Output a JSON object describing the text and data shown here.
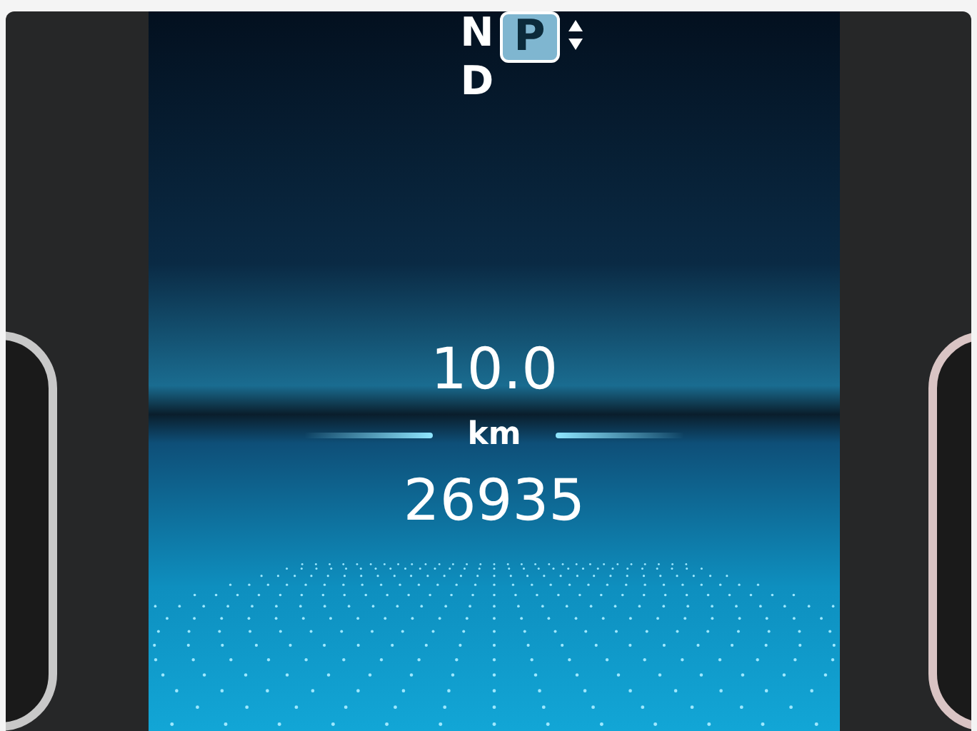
{
  "gear_selector": [
    {
      "label": "N",
      "selected": false
    },
    {
      "label": "P",
      "selected": true
    },
    {
      "label": "D",
      "selected": false
    }
  ],
  "trip": {
    "value": "10.0",
    "unit": "km"
  },
  "odometer": "26935"
}
